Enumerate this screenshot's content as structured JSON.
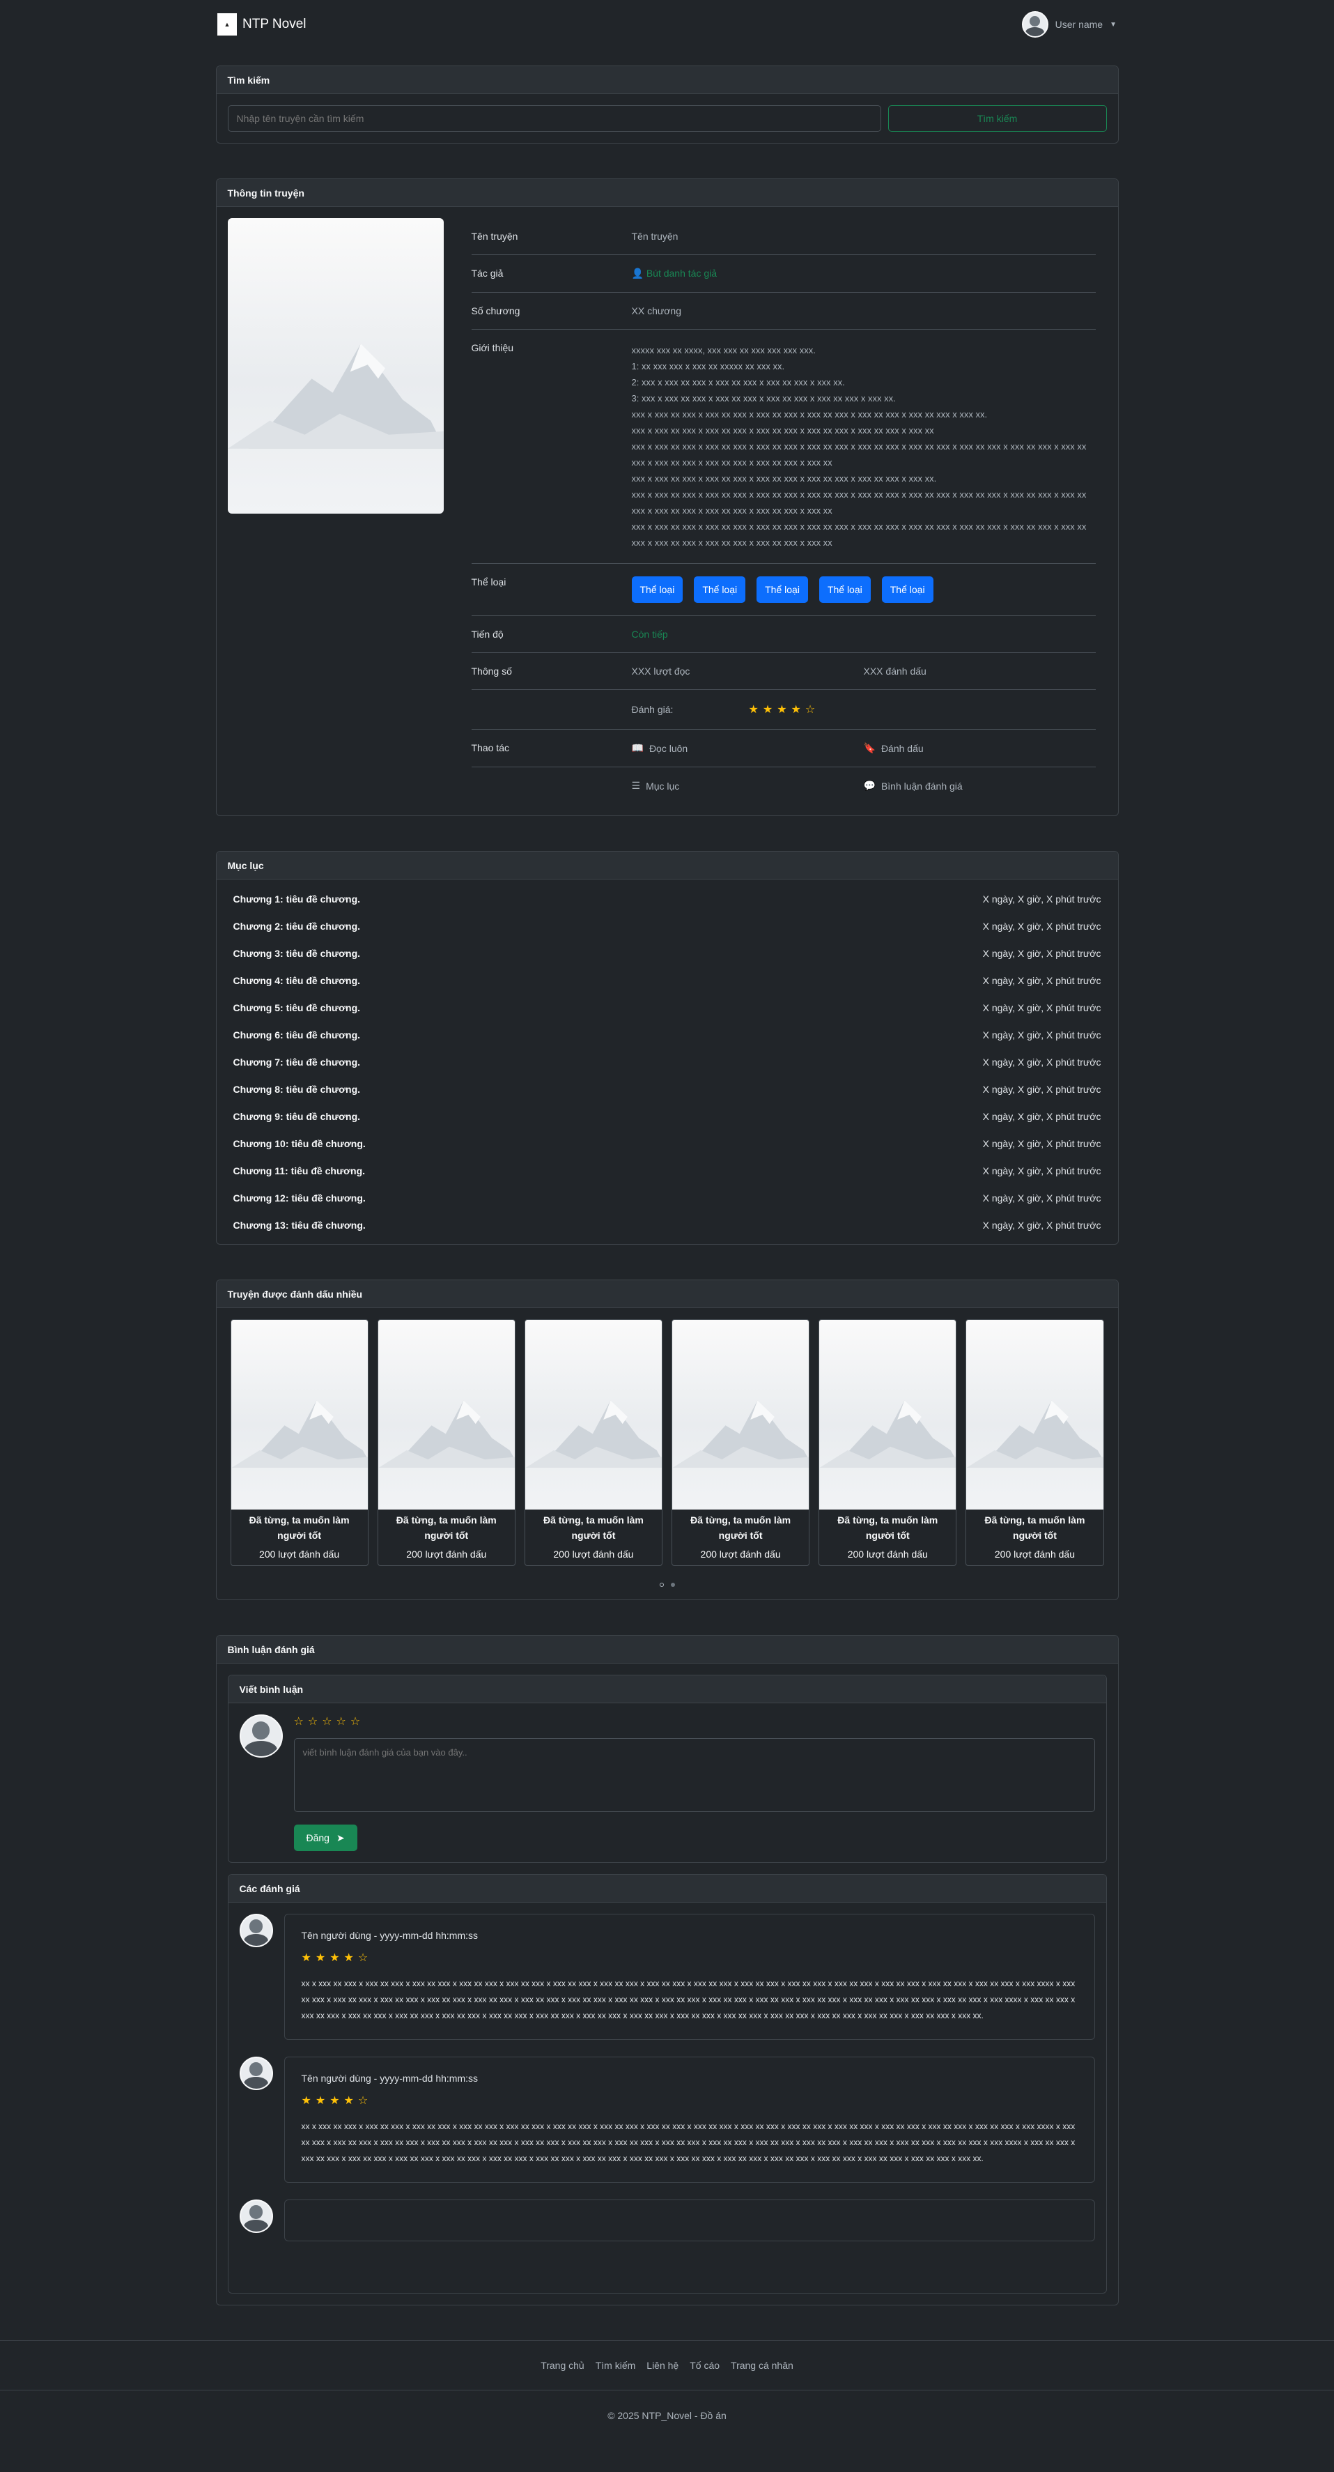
{
  "nav": {
    "brand": "NTP Novel",
    "user_name": "User name"
  },
  "search": {
    "title": "Tìm kiếm",
    "placeholder": "Nhập tên truyện cần tìm kiếm",
    "button": "Tìm kiếm"
  },
  "info": {
    "title": "Thông tin truyện",
    "labels": {
      "name": "Tên truyện",
      "author": "Tác giả",
      "chapters": "Số chương",
      "intro": "Giới thiệu",
      "genre": "Thể loại",
      "progress": "Tiến độ",
      "stats": "Thông số",
      "rating": "Đánh giá:",
      "actions": "Thao tác"
    },
    "name": "Tên truyện",
    "author": "Bút danh tác giả",
    "chapters": "XX chương",
    "intro": [
      "xxxxx xxx xx xxxx, xxx xxx xx xxx xxx xxx xxx.",
      "1: xx xxx xxx x xxx xx xxxxx xx xxx xx.",
      "2: xxx x xxx xx xxx x xxx xx xxx x xxx xx xxx x xxx xx.",
      "3: xxx x xxx xx xxx x xxx xx xxx x xxx xx xxx x xxx xx xxx x xxx xx.",
      "xxx x xxx xx xxx x xxx xx xxx x xxx xx xxx x xxx xx xxx x xxx xx xxx x xxx xx xxx x xxx xx.",
      "xxx x xxx xx xxx x xxx xx xxx x xxx xx xxx x xxx xx xxx x xxx xx xxx x xxx xx",
      "xxx x xxx xx xxx x xxx xx xxx x xxx xx xxx x xxx xx xxx x xxx xx xxx x xxx xx xxx x xxx xx xxx x xxx xx xxx x xxx xx xxx x xxx xx xxx x xxx xx xxx x xxx xx xxx x xxx xx",
      "xxx x xxx xx xxx x xxx xx xxx x xxx xx xxx x xxx xx xxx x xxx xx xxx x xxx xx.",
      "xxx x xxx xx xxx x xxx xx xxx x xxx xx xxx x xxx xx xxx x xxx xx xxx x xxx xx xxx x xxx xx xxx x xxx xx xxx x xxx xx xxx x xxx xx xxx x xxx xx xxx x xxx xx xxx x xxx xx",
      "xxx x xxx xx xxx x xxx xx xxx x xxx xx xxx x xxx xx xxx x xxx xx xxx x xxx xx xxx x xxx xx xxx x xxx xx xxx x xxx xx xxx x xxx xx xxx x xxx xx xxx x xxx xx xxx x xxx xx"
    ],
    "genres": [
      "Thể loại",
      "Thể loại",
      "Thể loại",
      "Thể loại",
      "Thể loại"
    ],
    "progress": "Còn tiếp",
    "views": "XXX lượt đọc",
    "bookmarks": "XXX đánh dấu",
    "rating_stars": "★★★★☆",
    "actions": {
      "read": "Đọc luôn",
      "bookmark": "Đánh dấu",
      "toc": "Mục lục",
      "comment": "Bình luận đánh giá"
    }
  },
  "toc": {
    "title": "Mục lục",
    "chapters": [
      {
        "title": "Chương 1: tiêu đề chương.",
        "time": "X ngày, X giờ, X phút trước"
      },
      {
        "title": "Chương 2: tiêu đề chương.",
        "time": "X ngày, X giờ, X phút trước"
      },
      {
        "title": "Chương 3: tiêu đề chương.",
        "time": "X ngày, X giờ, X phút trước"
      },
      {
        "title": "Chương 4: tiêu đề chương.",
        "time": "X ngày, X giờ, X phút trước"
      },
      {
        "title": "Chương 5: tiêu đề chương.",
        "time": "X ngày, X giờ, X phút trước"
      },
      {
        "title": "Chương 6: tiêu đề chương.",
        "time": "X ngày, X giờ, X phút trước"
      },
      {
        "title": "Chương 7: tiêu đề chương.",
        "time": "X ngày, X giờ, X phút trước"
      },
      {
        "title": "Chương 8: tiêu đề chương.",
        "time": "X ngày, X giờ, X phút trước"
      },
      {
        "title": "Chương 9: tiêu đề chương.",
        "time": "X ngày, X giờ, X phút trước"
      },
      {
        "title": "Chương 10: tiêu đề chương.",
        "time": "X ngày, X giờ, X phút trước"
      },
      {
        "title": "Chương 11: tiêu đề chương.",
        "time": "X ngày, X giờ, X phút trước"
      },
      {
        "title": "Chương 12: tiêu đề chương.",
        "time": "X ngày, X giờ, X phút trước"
      },
      {
        "title": "Chương 13: tiêu đề chương.",
        "time": "X ngày, X giờ, X phút trước"
      }
    ]
  },
  "popular": {
    "title": "Truyện được đánh dấu nhiều",
    "items": [
      {
        "title": "Đã từng, ta muốn làm người tốt",
        "count": "200 lượt đánh dấu"
      },
      {
        "title": "Đã từng, ta muốn làm người tốt",
        "count": "200 lượt đánh dấu"
      },
      {
        "title": "Đã từng, ta muốn làm người tốt",
        "count": "200 lượt đánh dấu"
      },
      {
        "title": "Đã từng, ta muốn làm người tốt",
        "count": "200 lượt đánh dấu"
      },
      {
        "title": "Đã từng, ta muốn làm người tốt",
        "count": "200 lượt đánh dấu"
      },
      {
        "title": "Đã từng, ta muốn làm người tốt",
        "count": "200 lượt đánh dấu"
      }
    ]
  },
  "comments": {
    "title": "Bình luận đánh giá",
    "write_title": "Viết bình luận",
    "empty_stars": "☆☆☆☆☆",
    "placeholder": "viết bình luận đánh giá của bạn vào đây..",
    "post_button": "Đăng",
    "list_title": "Các đánh giá",
    "reviews": [
      {
        "meta": "Tên người dùng - yyyy-mm-dd hh:mm:ss",
        "stars": "★★★★☆",
        "text": "xx x xxx xx xxx x xxx xx xxx x xxx xx xxx x xxx xx xxx x xxx xx xxx x xxx xx xxx x xxx xx xxx x xxx xx xxx x xxx xx xxx x xxx xx xxx x xxx xx xxx x xxx xx xxx x xxx xx xxx x xxx xx xxx x xxx xx xxx x xxx xxxx x xxx xx xxx x xxx xx xxx x xxx xx xxx x xxx xx xxx x xxx xx xxx x xxx xx xxx x xxx xx xxx x xxx xx xxx x xxx xx xxx x xxx xx xxx x xxx xx xxx x xxx xx xxx x xxx xx xxx x xxx xx xxx x xxx xx xxx x xxx xxxx x xxx xx xxx x xxx xx xxx x xxx xx xxx x xxx xx xxx x xxx xx xxx x xxx xx xxx x xxx xx xxx x xxx xx xxx x xxx xx xxx x xxx xx xxx x xxx xx xxx x xxx xx xxx x xxx xx xxx x xxx xx xxx x xxx xx xxx x xxx xx."
      },
      {
        "meta": "Tên người dùng - yyyy-mm-dd hh:mm:ss",
        "stars": "★★★★☆",
        "text": "xx x xxx xx xxx x xxx xx xxx x xxx xx xxx x xxx xx xxx x xxx xx xxx x xxx xx xxx x xxx xx xxx x xxx xx xxx x xxx xx xxx x xxx xx xxx x xxx xx xxx x xxx xx xxx x xxx xx xxx x xxx xx xxx x xxx xx xxx x xxx xxxx x xxx xx xxx x xxx xx xxx x xxx xx xxx x xxx xx xxx x xxx xx xxx x xxx xx xxx x xxx xx xxx x xxx xx xxx x xxx xx xxx x xxx xx xxx x xxx xx xxx x xxx xx xxx x xxx xx xxx x xxx xx xxx x xxx xx xxx x xxx xxxx x xxx xx xxx x xxx xx xxx x xxx xx xxx x xxx xx xxx x xxx xx xxx x xxx xx xxx x xxx xx xxx x xxx xx xxx x xxx xx xxx x xxx xx xxx x xxx xx xxx x xxx xx xxx x xxx xx xxx x xxx xx xxx x xxx xx xxx x xxx xx."
      }
    ]
  },
  "footer": {
    "links": [
      "Trang chủ",
      "Tìm kiếm",
      "Liên hệ",
      "Tố cáo",
      "Trang cá nhân"
    ],
    "copyright": "© 2025 NTP_Novel - Đồ án"
  }
}
